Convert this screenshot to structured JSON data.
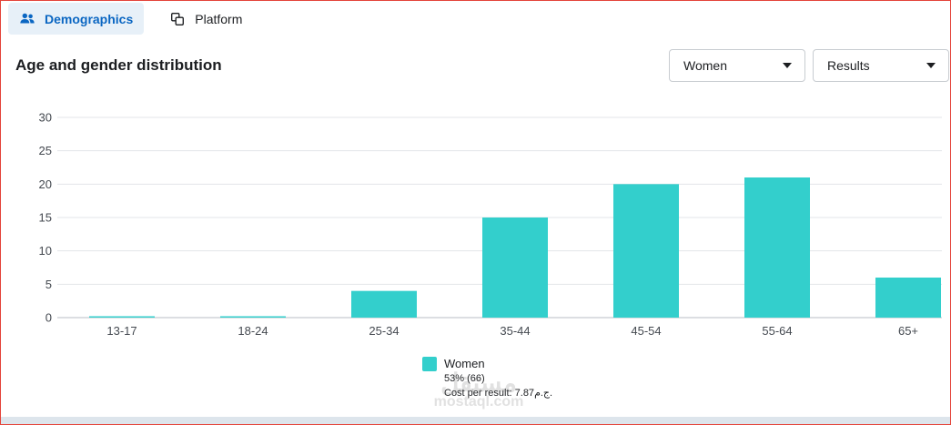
{
  "tabs": [
    {
      "label": "Demographics",
      "icon": "people-icon",
      "active": true
    },
    {
      "label": "Platform",
      "icon": "platform-icon",
      "active": false
    }
  ],
  "section_title": "Age and gender distribution",
  "filters": {
    "gender": {
      "selected": "Women"
    },
    "metric": {
      "selected": "Results"
    }
  },
  "colors": {
    "bar": "#33cfcc",
    "accent": "#0a66c2",
    "grid": "#e3e5e8"
  },
  "legend": {
    "name": "Women",
    "share": "53% (66)",
    "cost": "Cost per result: 7.87ج.م."
  },
  "watermark": {
    "arabic": "مستقل",
    "latin": "mostaql.com"
  },
  "chart_data": {
    "type": "bar",
    "title": "Age and gender distribution",
    "xlabel": "",
    "ylabel": "",
    "categories": [
      "13-17",
      "18-24",
      "25-34",
      "35-44",
      "45-54",
      "55-64",
      "65+"
    ],
    "series": [
      {
        "name": "Women",
        "values": [
          0,
          0,
          4,
          15,
          20,
          21,
          6
        ]
      }
    ],
    "ylim": [
      0,
      30
    ],
    "yticks": [
      0,
      5,
      10,
      15,
      20,
      25,
      30
    ],
    "grid": true,
    "legend_position": "bottom"
  }
}
